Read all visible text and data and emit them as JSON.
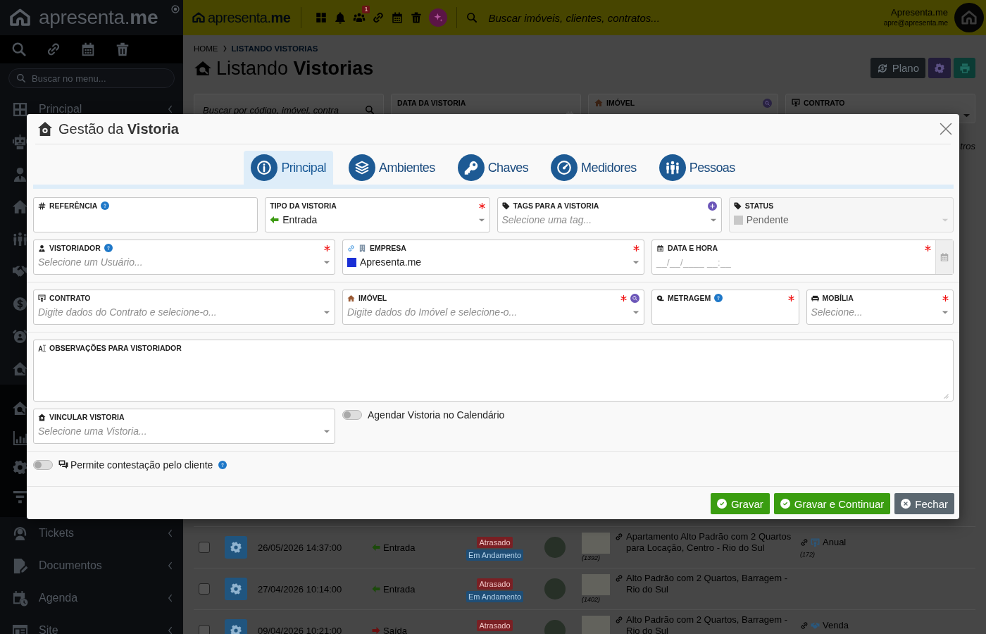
{
  "sidebar": {
    "logo": "apresenta.**me**",
    "search": {
      "placeholder": "Buscar no menu..."
    },
    "items": [
      {
        "kind": "entry",
        "label": "Principal",
        "expanded": false
      },
      {
        "kind": "icon"
      },
      {
        "kind": "icon"
      },
      {
        "kind": "icon"
      },
      {
        "kind": "icon"
      },
      {
        "kind": "icon"
      },
      {
        "kind": "icon"
      },
      {
        "kind": "icon"
      },
      {
        "kind": "icon",
        "expanded": true,
        "children": [
          {
            "kind": "icon"
          },
          {
            "kind": "icon"
          },
          {
            "kind": "icon"
          },
          {
            "kind": "icon"
          }
        ]
      },
      {
        "kind": "entry",
        "label": "Tickets",
        "expanded": false
      },
      {
        "kind": "entry",
        "label": "Documentos",
        "expanded": false
      },
      {
        "kind": "entry",
        "label": "Agenda",
        "expanded": false
      },
      {
        "kind": "entry",
        "label": "Site",
        "expanded": false
      }
    ]
  },
  "topbar": {
    "logo": "apresenta.**me**",
    "notification_count": "1",
    "search": {
      "placeholder": "Buscar imóveis, clientes, contratos..."
    },
    "user": {
      "name": "Apresenta.me",
      "email": "apre@apresenta.me"
    }
  },
  "page": {
    "breadcrumb": [
      {
        "label": "HOME",
        "selected": false
      },
      {
        "label": "LISTANDO VISTORIAS",
        "selected": true
      }
    ],
    "title": "Listando **Vistorias**",
    "actions": [
      {
        "kind": "plan",
        "label": "Plano"
      },
      {
        "kind": "settings"
      },
      {
        "kind": "print"
      }
    ],
    "filters": [
      {
        "kind": "search",
        "placeholder": "Buscar por código, imóvel, contra"
      },
      {
        "kind": "date",
        "label": "DATA DA VISTORIA"
      },
      {
        "kind": "lookup",
        "label": "IMÓVEL"
      },
      {
        "kind": "select",
        "label": "CONTRATO"
      }
    ],
    "filter_link": "tros",
    "rows": [
      {
        "selected": false,
        "date": "26/05/2026 14:37:00",
        "type": {
          "kind": "arrow_in",
          "label": "Entrada"
        },
        "badges": [
          {
            "label": "Atrasado",
            "color": "#7a2024"
          },
          {
            "label": "Em Andamento",
            "color": "#1f4e76"
          }
        ],
        "property": "Apartamento Alto Padrão com 2 Quartos para Locação, Centro - Rio do Sul",
        "code": "(1392)",
        "contract": {
          "kind": "rental",
          "label": "Anual",
          "code": "(172)"
        }
      },
      {
        "selected": false,
        "date": "27/04/2026 10:14:00",
        "type": {
          "kind": "arrow_in",
          "label": "Entrada"
        },
        "badges": [
          {
            "label": "Atrasado",
            "color": "#7a2024"
          },
          {
            "label": "Em Andamento",
            "color": "#1f4e76"
          }
        ],
        "property": "Alto Padrão com 2 Quartos, Barragem - Rio do Sul",
        "code": "(1402)"
      },
      {
        "selected": false,
        "date": "09/04/2026 10:21:00",
        "type": {
          "kind": "arrow_out",
          "label": "Saída"
        },
        "badges": [
          {
            "label": "Atrasado",
            "color": "#7a2024"
          }
        ],
        "property": "Alto Padrão com 2 Quartos, Barragem - Rio do Sul",
        "contract": {
          "kind": "sale",
          "label": "Venda"
        }
      }
    ]
  },
  "modal": {
    "title": "Gestão da **Vistoria**",
    "tabs": [
      {
        "label": "Principal",
        "selected": true
      },
      {
        "label": "Ambientes",
        "selected": false
      },
      {
        "label": "Chaves",
        "selected": false
      },
      {
        "label": "Medidores",
        "selected": false
      },
      {
        "label": "Pessoas",
        "selected": false
      }
    ],
    "sections": [
      [
        [
          {
            "kind": "text",
            "label": "REFERÊNCIA",
            "help": true,
            "required": false,
            "disabled": false
          },
          {
            "kind": "select",
            "label": "TIPO DA VISTORIA",
            "help": false,
            "required": true,
            "disabled": false,
            "value": {
              "kind": "arrow_in",
              "text": "Entrada"
            }
          },
          {
            "kind": "select",
            "label": "TAGS PARA A VISTORIA",
            "help": false,
            "required": false,
            "disabled": false,
            "action": {
              "kind": "add"
            },
            "placeholder": "Selecione uma tag..."
          },
          {
            "kind": "select",
            "label": "STATUS",
            "help": false,
            "required": false,
            "disabled": true,
            "value": {
              "kind": "swatch",
              "text": "Pendente",
              "color": "#c8c8c8"
            }
          }
        ],
        [
          {
            "kind": "select",
            "label": "VISTORIADOR",
            "help": true,
            "required": true,
            "disabled": false,
            "placeholder": "Selecione um Usuário..."
          },
          {
            "kind": "select",
            "label": "EMPRESA",
            "help": false,
            "required": true,
            "disabled": false,
            "value": {
              "kind": "swatch",
              "text": "Apresenta.me",
              "color": "#1a2fd6"
            }
          },
          {
            "kind": "date",
            "label": "DATA E HORA",
            "help": false,
            "required": true,
            "disabled": false,
            "placeholder": "__/__/____ __:__"
          }
        ]
      ],
      [
        [
          {
            "kind": "select",
            "label": "CONTRATO",
            "help": false,
            "required": false,
            "disabled": false,
            "placeholder": "Digite dados do Contrato e selecione-o..."
          },
          {
            "kind": "select",
            "label": "IMÓVEL",
            "help": false,
            "required": true,
            "disabled": false,
            "action": {
              "kind": "search"
            },
            "placeholder": "Digite dados do Imóvel e selecione-o..."
          },
          {
            "kind": "text",
            "label": "METRAGEM",
            "help": true,
            "required": true,
            "disabled": false
          },
          {
            "kind": "select",
            "label": "MOBÍLIA",
            "help": false,
            "required": true,
            "disabled": false,
            "placeholder": "Selecione..."
          }
        ]
      ],
      [
        [
          {
            "kind": "textarea",
            "label": "OBSERVAÇÕES PARA VISTORIADOR",
            "help": false,
            "required": false,
            "disabled": false
          }
        ],
        [
          {
            "kind": "select",
            "label": "VINCULAR VISTORIA",
            "help": false,
            "required": false,
            "disabled": false,
            "placeholder": "Selecione uma Vistoria..."
          },
          {
            "kind": "switch",
            "label": "Agendar Vistoria no Calendário",
            "on": false,
            "help": false
          }
        ]
      ],
      [
        [
          {
            "kind": "switch",
            "label": "Permite contestação pelo cliente",
            "on": false,
            "help": true
          }
        ]
      ]
    ],
    "buttons": [
      {
        "kind": "save",
        "label": "Gravar"
      },
      {
        "kind": "save_continue",
        "label": "Gravar e Continuar"
      },
      {
        "kind": "close",
        "label": "Fechar"
      }
    ]
  }
}
